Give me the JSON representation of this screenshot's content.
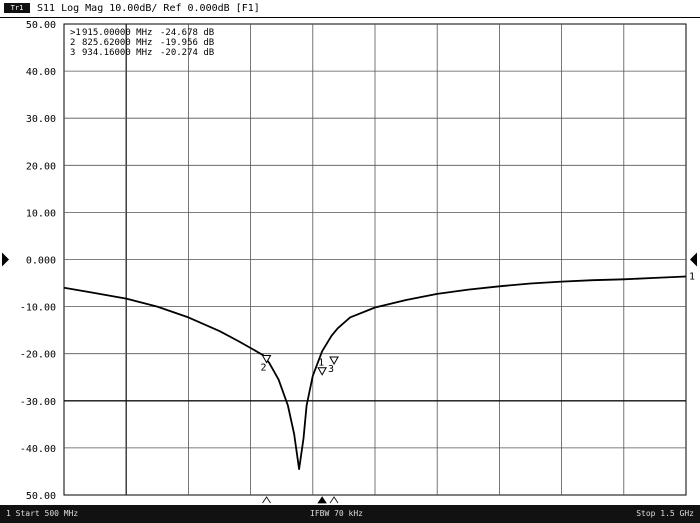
{
  "header": {
    "trace_badge": "Tr1",
    "title": "S11 Log Mag 10.00dB/ Ref 0.000dB [F1]"
  },
  "markers": [
    {
      "label": ">1",
      "freq": "915.00000 MHz",
      "value": "-24.678 dB"
    },
    {
      "label": "2",
      "freq": "825.62000 MHz",
      "value": "-19.956 dB"
    },
    {
      "label": "3",
      "freq": "934.16000 MHz",
      "value": "-20.274 dB"
    }
  ],
  "footer": {
    "start": "1 Start 500 MHz",
    "ifbw": "IFBW 70 kHz",
    "stop": "Stop 1.5 GHz"
  },
  "chart_data": {
    "type": "line",
    "title": "S11 Log Mag 10.00dB/ Ref 0.000dB [F1]",
    "x_unit": "MHz",
    "xlim": [
      500,
      1500
    ],
    "ylim": [
      -50,
      50
    ],
    "y_ticks": [
      "50.00",
      "40.00",
      "30.00",
      "20.00",
      "10.00",
      "0.000",
      "-10.00",
      "-20.00",
      "-30.00",
      "-40.00",
      "50.00"
    ],
    "reference_level": 0,
    "grid": true,
    "series": [
      {
        "x": [
          500,
          540,
          600,
          650,
          700,
          750,
          780,
          800,
          820,
          830,
          845,
          860,
          870,
          878,
          885,
          890,
          900,
          915,
          930,
          940,
          960,
          1000,
          1050,
          1100,
          1150,
          1200,
          1250,
          1300,
          1350,
          1400,
          1450,
          1500
        ],
        "y": [
          -6,
          -6.9,
          -8.3,
          -10,
          -12.3,
          -15.2,
          -17.3,
          -18.8,
          -20.3,
          -22,
          -25.5,
          -31,
          -37,
          -44.5,
          -38,
          -31,
          -24.7,
          -19.5,
          -16.2,
          -14.6,
          -12.3,
          -10.2,
          -8.6,
          -7.3,
          -6.4,
          -5.7,
          -5.1,
          -4.7,
          -4.4,
          -4.2,
          -3.9,
          -3.6
        ]
      }
    ],
    "marker_points": [
      {
        "label": "1",
        "x": 915,
        "y": -24.678
      },
      {
        "label": "2",
        "x": 825.62,
        "y": -19.956
      },
      {
        "label": "3",
        "x": 934.16,
        "y": -20.274
      }
    ],
    "trace_end_label": "1"
  }
}
